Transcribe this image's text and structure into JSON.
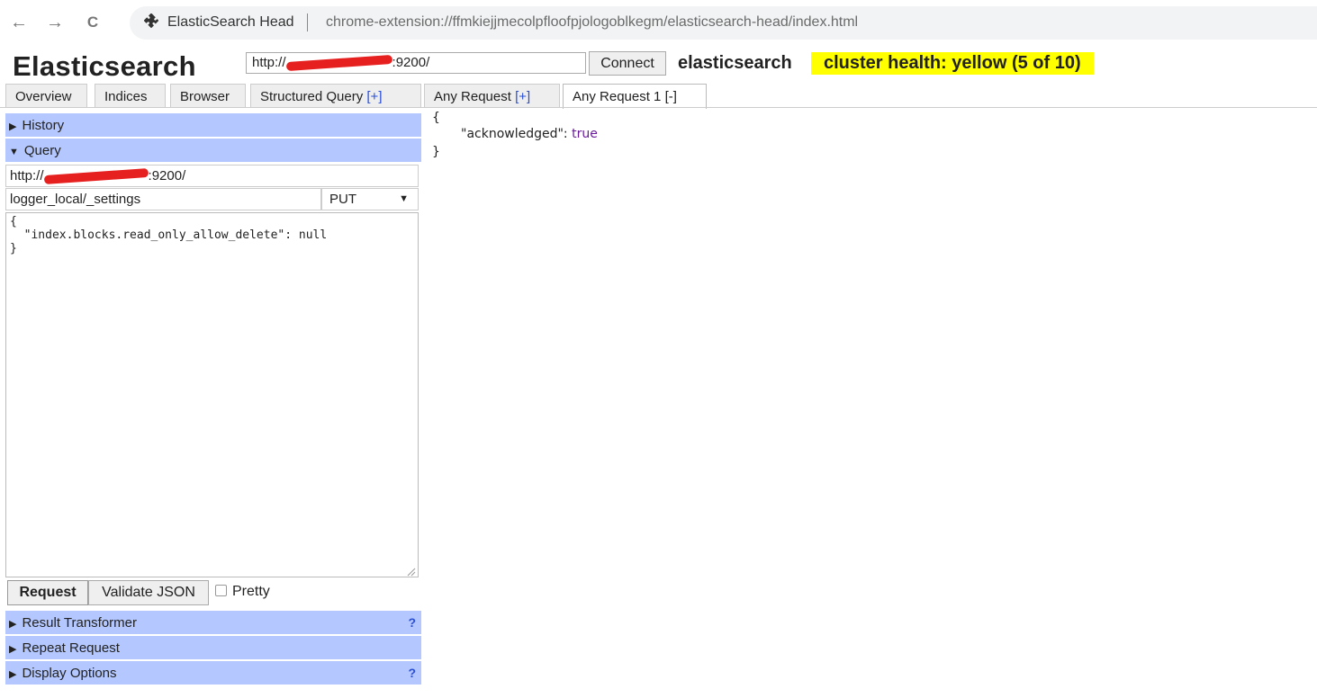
{
  "browser": {
    "back_glyph": "←",
    "forward_glyph": "→",
    "reload_glyph": "C",
    "extension_icon": "puzzle-icon",
    "page_title": "ElasticSearch Head",
    "url": "chrome-extension://ffmkiejjmecolpfloofpjologoblkegm/elasticsearch-head/index.html"
  },
  "header": {
    "app_title": "Elasticsearch",
    "connection_url_prefix": "http://",
    "connection_url_suffix": ":9200/",
    "connect_label": "Connect",
    "cluster_name": "elasticsearch",
    "cluster_health": "cluster health: yellow (5 of 10)",
    "health_color": "#ffff00"
  },
  "tabs": [
    {
      "label": "Overview"
    },
    {
      "label": "Indices"
    },
    {
      "label": "Browser"
    },
    {
      "label": "Structured Query ",
      "suffix": "[+]"
    },
    {
      "label": "Any Request ",
      "suffix": "[+]"
    },
    {
      "label": "Any Request 1 ",
      "suffix": "[-]",
      "active": true
    }
  ],
  "sections": {
    "history": "History",
    "query": "Query",
    "result_transformer": "Result Transformer",
    "repeat_request": "Repeat Request",
    "display_options": "Display Options",
    "help_glyph": "?",
    "section_color": "#b4c8ff"
  },
  "query": {
    "url_prefix": "http://",
    "url_suffix": ":9200/",
    "path": "logger_local/_settings",
    "method": "PUT",
    "body": "{\n  \"index.blocks.read_only_allow_delete\": null\n}",
    "request_label": "Request",
    "validate_label": "Validate JSON",
    "pretty_label": "Pretty",
    "pretty_checked": false
  },
  "result": {
    "open_brace": "{",
    "key": "\"acknowledged\": ",
    "value": "true",
    "close_brace": "}"
  }
}
